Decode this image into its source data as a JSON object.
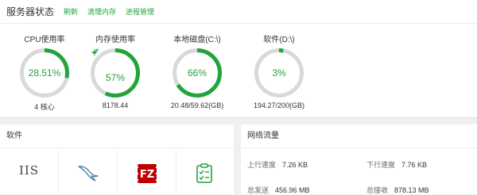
{
  "header": {
    "title": "服务器状态",
    "links": [
      "刷新",
      "清理内存",
      "进程管理"
    ]
  },
  "gauges": [
    {
      "label": "CPU使用率",
      "value": "28.51%",
      "percent": 28.51,
      "sub": "4 核心"
    },
    {
      "label": "内存使用率",
      "value": "57%",
      "percent": 57,
      "sub": "8178.44"
    },
    {
      "label": "本地磁盘(C:\\)",
      "value": "66%",
      "percent": 66,
      "sub": "20.48/59.62(GB)"
    },
    {
      "label": "软件(D:\\)",
      "value": "3%",
      "percent": 3,
      "sub": "194.27/200(GB)"
    }
  ],
  "software": {
    "title": "软件",
    "items": [
      {
        "icon": "iis-icon",
        "text": "IIS"
      },
      {
        "icon": "mysql-dolphin-icon"
      },
      {
        "icon": "filezilla-icon",
        "text": "FZ"
      },
      {
        "icon": "task-checklist-icon"
      }
    ]
  },
  "network": {
    "title": "网络流量",
    "upload_speed_label": "上行速度",
    "upload_speed": "7.26 KB",
    "download_speed_label": "下行速度",
    "download_speed": "7.76 KB",
    "total_sent_label": "总发送",
    "total_sent": "456.96 MB",
    "total_received_label": "总接收",
    "total_received": "878.13 MB"
  },
  "colors": {
    "accent": "#20a53a",
    "ring_track": "#d9d9d9",
    "filezilla_red": "#bf0000"
  }
}
